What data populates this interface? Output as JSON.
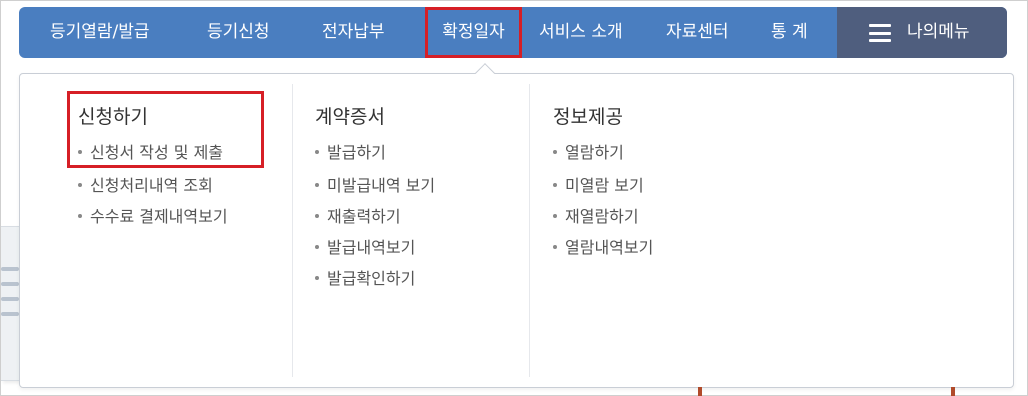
{
  "nav": {
    "items": [
      {
        "label": "등기열람/발급"
      },
      {
        "label": "등기신청"
      },
      {
        "label": "전자납부"
      },
      {
        "label": "확정일자"
      },
      {
        "label": "서비스 소개"
      },
      {
        "label": "자료센터"
      },
      {
        "label": "통 계"
      }
    ],
    "my_menu_label": "나의메뉴",
    "active_index": 3
  },
  "dropdown": {
    "columns": [
      {
        "title": "신청하기",
        "links": [
          "신청서 작성 및 제출",
          "신청처리내역 조회",
          "수수료 결제내역보기"
        ]
      },
      {
        "title": "계약증서",
        "links": [
          "발급하기",
          "미발급내역 보기",
          "재출력하기",
          "발급내역보기",
          "발급확인하기"
        ]
      },
      {
        "title": "정보제공",
        "links": [
          "열람하기",
          "미열람 보기",
          "재열람하기",
          "열람내역보기"
        ]
      }
    ]
  },
  "colors": {
    "nav_bg": "#4a7ec0",
    "my_menu_bg": "#4f5e7e",
    "highlight": "#d61f26"
  }
}
